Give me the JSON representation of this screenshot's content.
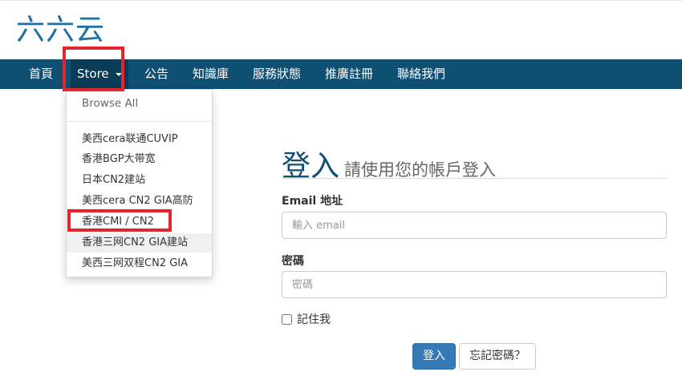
{
  "site": {
    "logo_text": "六六云"
  },
  "nav": {
    "items": [
      {
        "label": "首頁"
      },
      {
        "label": "Store"
      },
      {
        "label": "公告"
      },
      {
        "label": "知識庫"
      },
      {
        "label": "服務狀態"
      },
      {
        "label": "推廣註冊"
      },
      {
        "label": "聯絡我們"
      }
    ]
  },
  "store_menu": {
    "browse_all": "Browse All",
    "items": [
      {
        "label": "美西cera联通CUVIP"
      },
      {
        "label": "香港BGP大带宽"
      },
      {
        "label": "日本CN2建站"
      },
      {
        "label": "美西cera CN2 GIA高防"
      },
      {
        "label": "香港CMI / CN2"
      },
      {
        "label": "香港三网CN2 GIA建站"
      },
      {
        "label": "美西三网双程CN2 GIA"
      }
    ]
  },
  "login": {
    "title": "登入",
    "subtitle": "請使用您的帳戶登入",
    "email_label": "Email 地址",
    "email_placeholder": "輸入 email",
    "password_label": "密碼",
    "password_placeholder": "密碼",
    "remember_label": "記住我",
    "submit_label": "登入",
    "forgot_label": "忘記密碼？"
  },
  "colors": {
    "navbar": "#0e4f72",
    "navbar_active": "#0a3b57",
    "logo": "#1f6fa3",
    "primary_button": "#337ab7",
    "highlight": "#e4262c"
  }
}
